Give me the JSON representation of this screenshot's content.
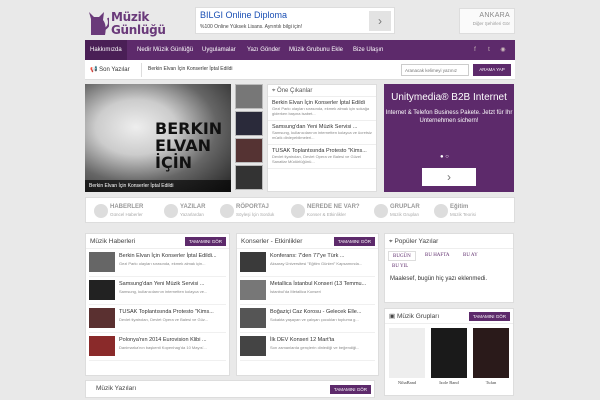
{
  "header": {
    "logo_line1": "Müzik",
    "logo_line2": "Günlüğü",
    "ad": {
      "title": "BILGI Online Diploma",
      "subtitle": "%100 Online Yüksek Lisans. Ayrıntılı bilgi için!"
    },
    "weather": {
      "city": "ANKARA",
      "other": "Diğer Şehirleri Gör"
    }
  },
  "nav": {
    "items": [
      "Hakkımızda",
      "Nedir Müzik Günlüğü",
      "Uygulamalar",
      "Yazı Gönder",
      "Müzik Grubunu Ekle",
      "Bize Ulaşın"
    ]
  },
  "ticker": {
    "label": "Son Yazılar",
    "text": "Berkin Elvan İçin Konserler İptal Edildi",
    "search_placeholder": "Aranacak kelimeyi yazınız",
    "search_button": "ARAMA YAP"
  },
  "slider": {
    "poster_text": "BERKIN ELVAN İÇİN",
    "caption": "Berkin Elvan İçin Konserler İptal Edildi"
  },
  "featured": {
    "title": "Öne Çıkanlar",
    "items": [
      {
        "title": "Berkin Elvan İçin Konserler İptal Edildi",
        "desc": "Gezi Parkı olayları sırasında, ekmek almak için sokağa giderken başına isabet..."
      },
      {
        "title": "Samsung'dan Yeni Müzik Servisi ...",
        "desc": "Samsung, kullanıcılarının internetten kolayca ve ücretsiz müzik dinleyebilmeleri..."
      },
      {
        "title": "TUSAK Toplantısında Protesto \"Kims...",
        "desc": "Devlet tiyatroları, Devlet Opera ve Balesi ve Güzel Sanatlar Müdürlüğünü..."
      }
    ]
  },
  "side_ad": {
    "headline": "Unitymedia® B2B Internet",
    "body": "Internet & Telefon Business Pakete. Jetzt für Ihr Unternehmen sichern!",
    "dots": "●  ○"
  },
  "categories": [
    {
      "name": "HABERLER",
      "sub": "Güncel Haberler"
    },
    {
      "name": "YAZILAR",
      "sub": "Yazarlardan"
    },
    {
      "name": "RÖPORTAJ",
      "sub": "Söyleşi İçin Sorduk"
    },
    {
      "name": "NEREDE NE VAR?",
      "sub": "Konser & Etkinlikler"
    },
    {
      "name": "GRUPLAR",
      "sub": "Müzik Grupları"
    },
    {
      "name": "Eğitim",
      "sub": "Müzik Teorisi"
    }
  ],
  "news": {
    "title": "Müzik Haberleri",
    "more": "TAMAMINI GÖR",
    "items": [
      {
        "title": "Berkin Elvan İçin Konserler İptal Edildi...",
        "desc": "Gezi Parkı olayları sırasında, ekmek almak için..."
      },
      {
        "title": "Samsung'dan Yeni Müzik Servisi ...",
        "desc": "Samsung, kullanıcılarının internetten kolayca ve..."
      },
      {
        "title": "TUSAK Toplantısında Protesto \"Kims...",
        "desc": "Devlet tiyatroları, Devlet Opera ve Balesi ve Güz..."
      },
      {
        "title": "Polonya'nın 2014 Eurovision Klibi ...",
        "desc": "Danimarka'nın başkenti Kopenhag'da 10 Mayıs'..."
      }
    ]
  },
  "concerts": {
    "title": "Konserler - Etkinlikler",
    "more": "TAMAMINI GÖR",
    "items": [
      {
        "title": "Konferans: 7'den 77'ye Türk ...",
        "desc": "Aksaray Üniversitesi \"Eğitim Günleri\" Kapsamında..."
      },
      {
        "title": "Metallica İstanbul Konseri (13 Temmu...",
        "desc": "İstanbul'da Metallica Konseri"
      },
      {
        "title": "Boğaziçi Caz Korosu - Gelecek Elle...",
        "desc": "Sokakta yaşayan ve çalışan çocukları topluma g..."
      },
      {
        "title": "İlk DEV Konseri 12 Mart'ta",
        "desc": "Son zamanlarda gençlerin dinlediği ve beğendiği..."
      }
    ]
  },
  "popular": {
    "title": "Popüler Yazılar",
    "tabs": [
      "BUGÜN",
      "BU HAFTA",
      "BU AY",
      "BU YIL"
    ],
    "message": "Maalesef, bugün hiç yazı eklenmedi."
  },
  "groups": {
    "title": "Müzik Grupları",
    "more": "TAMAMINI GÖR",
    "items": [
      "NihaBand",
      "Izole Band",
      "Tufan"
    ]
  },
  "bottom": {
    "title": "Müzik Yazıları",
    "more": "TAMAMINI GÖR"
  }
}
